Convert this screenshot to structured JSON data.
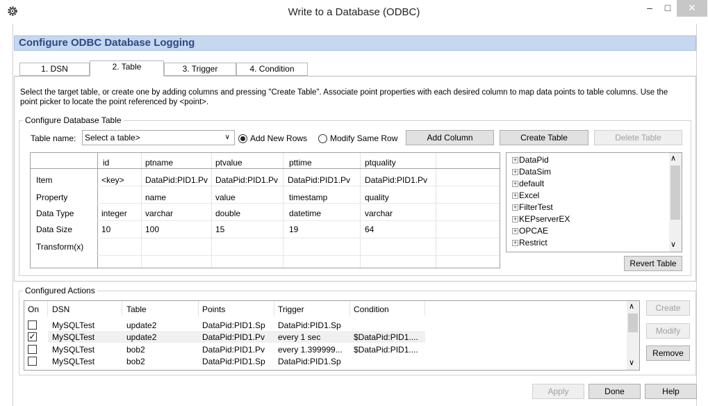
{
  "window": {
    "title": "Write to a Database (ODBC)",
    "minimize_glyph": "–",
    "maximize_glyph": "□",
    "close_glyph": "✕",
    "icon": "gear-icon"
  },
  "header": {
    "title": "Configure ODBC Database Logging"
  },
  "tabs": [
    {
      "label": "1. DSN"
    },
    {
      "label": "2. Table"
    },
    {
      "label": "3. Trigger"
    },
    {
      "label": "4. Condition"
    }
  ],
  "description": "Select the target table, or create one by adding columns and pressing \"Create Table\".  Associate point properties with each desired column to map data points to table columns.  Use the point picker to locate the point referenced by <point>.",
  "configure_table": {
    "group_label": "Configure Database Table",
    "table_name_label": "Table name:",
    "table_name_value": "Select a table>",
    "add_rows_label": "Add New Rows",
    "modify_row_label": "Modify Same Row",
    "add_column_label": "Add Column",
    "create_table_label": "Create Table",
    "delete_table_label": "Delete Table",
    "revert_table_label": "Revert Table"
  },
  "mapping_grid": {
    "row_labels": [
      "Item",
      "Property",
      "Data Type",
      "Data Size",
      "Transform(x)"
    ],
    "columns": [
      {
        "header": "id",
        "cells": [
          "<key>",
          "",
          "integer",
          "10",
          ""
        ]
      },
      {
        "header": "ptname",
        "cells": [
          "DataPid:PID1.Pv",
          "name",
          "varchar",
          "100",
          ""
        ]
      },
      {
        "header": "ptvalue",
        "cells": [
          "DataPid:PID1.Pv",
          "value",
          "double",
          "15",
          ""
        ]
      },
      {
        "header": "pttime",
        "cells": [
          "DataPid:PID1.Pv",
          "timestamp",
          "datetime",
          "19",
          ""
        ]
      },
      {
        "header": "ptquality",
        "cells": [
          "DataPid:PID1.Pv",
          "quality",
          "varchar",
          "64",
          ""
        ]
      }
    ]
  },
  "point_tree": {
    "items": [
      "DataPid",
      "DataSim",
      "default",
      "Excel",
      "FilterTest",
      "KEPserverEX",
      "OPCAE",
      "Restrict"
    ]
  },
  "actions": {
    "group_label": "Configured Actions",
    "headers": [
      "On",
      "DSN",
      "Table",
      "Points",
      "Trigger",
      "Condition"
    ],
    "rows": [
      {
        "on": false,
        "dsn": "MySQLTest",
        "table": "update2",
        "points": "DataPid:PID1.Sp",
        "trigger": "DataPid:PID1.Sp",
        "condition": ""
      },
      {
        "on": true,
        "dsn": "MySQLTest",
        "table": "update2",
        "points": "DataPid:PID1.Pv",
        "trigger": "every 1 sec",
        "condition": "$DataPid:PID1...."
      },
      {
        "on": false,
        "dsn": "MySQLTest",
        "table": "bob2",
        "points": "DataPid:PID1.Pv",
        "trigger": "every 1.399999...",
        "condition": "$DataPid:PID1...."
      },
      {
        "on": false,
        "dsn": "MySQLTest",
        "table": "bob2",
        "points": "DataPid:PID1.Sp",
        "trigger": "DataPid:PID1.Sp",
        "condition": ""
      }
    ],
    "create_label": "Create",
    "modify_label": "Modify",
    "remove_label": "Remove"
  },
  "footer": {
    "apply_label": "Apply",
    "done_label": "Done",
    "help_label": "Help"
  },
  "colors": {
    "header_band": "#c6d7f0",
    "header_text": "#2b4a83",
    "selected_row": "#f0f0f0"
  }
}
